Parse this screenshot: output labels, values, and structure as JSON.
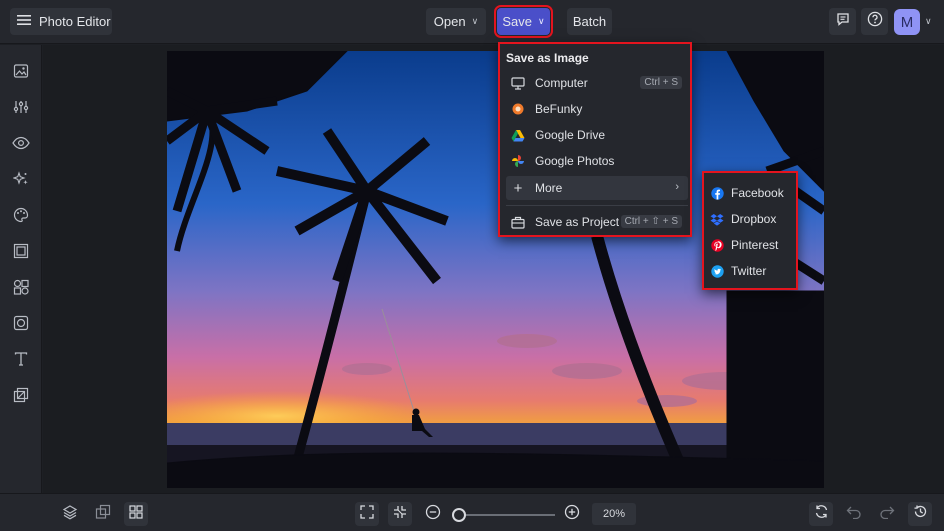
{
  "app": {
    "title": "Photo Editor"
  },
  "toolbar": {
    "open_label": "Open",
    "save_label": "Save",
    "batch_label": "Batch",
    "avatar_initial": "M"
  },
  "save_menu": {
    "heading": "Save as Image",
    "items": [
      {
        "label": "Computer",
        "shortcut": "Ctrl + S",
        "icon": "monitor-icon"
      },
      {
        "label": "BeFunky",
        "icon": "befunky-icon"
      },
      {
        "label": "Google Drive",
        "icon": "google-drive-icon"
      },
      {
        "label": "Google Photos",
        "icon": "google-photos-icon"
      },
      {
        "label": "More",
        "icon": "plus-icon"
      },
      {
        "label": "Save as Project",
        "shortcut": "Ctrl + ⇧ + S",
        "icon": "project-icon"
      }
    ]
  },
  "more_submenu": {
    "items": [
      {
        "label": "Facebook",
        "icon": "facebook-icon"
      },
      {
        "label": "Dropbox",
        "icon": "dropbox-icon"
      },
      {
        "label": "Pinterest",
        "icon": "pinterest-icon"
      },
      {
        "label": "Twitter",
        "icon": "twitter-icon"
      }
    ]
  },
  "zoom": {
    "value_label": "20%",
    "level": 0.05
  },
  "colors": {
    "save_accent": "#4a4fc9",
    "highlight_border": "#e4141e",
    "avatar": "#8f93f5"
  }
}
